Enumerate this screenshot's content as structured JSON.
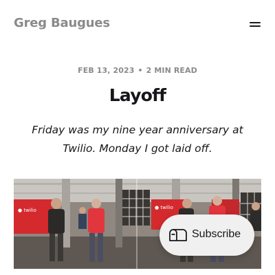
{
  "header": {
    "site_title": "Greg Baugues",
    "menu_icon": "hamburger-menu-icon"
  },
  "post": {
    "date": "FEB 13, 2023",
    "separator": "•",
    "read_time": "2 MIN READ",
    "title": "Layoff",
    "excerpt": "Friday was my nine year anniversary at Twilio. Monday I got laid off.",
    "feature_image_alt": "",
    "feature_image_signs": [
      "twilio",
      "twilio"
    ]
  },
  "subscribe": {
    "label": "Subscribe",
    "icon": "mailbox-icon"
  },
  "colors": {
    "text": "#15171a",
    "muted": "#8a8a8a",
    "twilio_red": "#e1262d",
    "subscribe_bg": "#f0f0f0"
  }
}
